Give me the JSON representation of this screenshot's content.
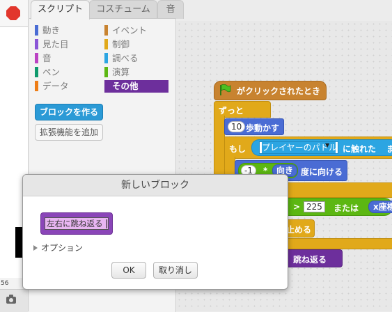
{
  "tabs": [
    "スクリプト",
    "コスチューム",
    "音"
  ],
  "stage": {
    "readout": "56"
  },
  "palette": {
    "categories": [
      {
        "label": "動き",
        "color": "#4a6cd4"
      },
      {
        "label": "イベント",
        "color": "#c88330"
      },
      {
        "label": "見た目",
        "color": "#8a55d7"
      },
      {
        "label": "制御",
        "color": "#e1a91a"
      },
      {
        "label": "音",
        "color": "#bb42c3"
      },
      {
        "label": "調べる",
        "color": "#2ca5e2"
      },
      {
        "label": "ペン",
        "color": "#0e9a6c"
      },
      {
        "label": "演算",
        "color": "#5cb712"
      },
      {
        "label": "データ",
        "color": "#ee7d16"
      },
      {
        "label": "その他",
        "color": "#6d2f9c"
      }
    ],
    "make_block": "ブロックを作る",
    "add_extension": "拡張機能を追加"
  },
  "script": {
    "hat": "がクリックされたとき",
    "forever": "ずっと",
    "move_steps": "10",
    "move_label": "歩動かす",
    "if_label": "もし",
    "sensing_menu": "プレイヤーのパドル",
    "touching_label": "に触れた",
    "overflow_right": "ま",
    "point_minus": "-1",
    "point_times": "*",
    "point_dir": "向き",
    "point_label": "度に向ける",
    "gt": ">",
    "num225": "225",
    "or_label": "または",
    "xpos_label": "x座標",
    "stop_label": "止める",
    "bounce_label": "ら、跳ね返る"
  },
  "dialog": {
    "title": "新しいブロック",
    "block_name": "左右に跳ね返る",
    "options": "オプション",
    "ok": "OK",
    "cancel": "取り消し"
  }
}
